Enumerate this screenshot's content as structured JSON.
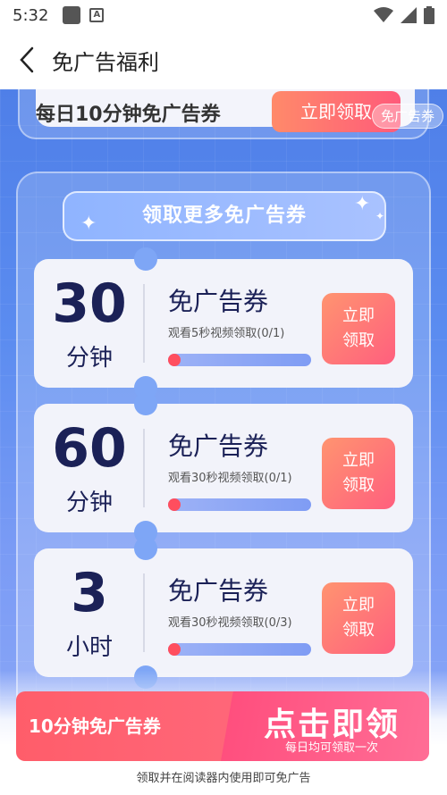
{
  "status": {
    "time": "5:32",
    "notice_letter": "A"
  },
  "nav": {
    "title": "免广告福利"
  },
  "top_card": {
    "text": "每日10分钟免广告券",
    "button": "立即领取",
    "badge": "免广告券"
  },
  "section": {
    "header": "领取更多免广告券"
  },
  "coupons": [
    {
      "amount": "30",
      "unit": "分钟",
      "title": "免广告券",
      "desc": "观看5秒视频领取(0/1)",
      "progress": 0,
      "btn_line1": "立即",
      "btn_line2": "领取"
    },
    {
      "amount": "60",
      "unit": "分钟",
      "title": "免广告券",
      "desc": "观看30秒视频领取(0/1)",
      "progress": 0,
      "btn_line1": "立即",
      "btn_line2": "领取"
    },
    {
      "amount": "3",
      "unit": "小时",
      "title": "免广告券",
      "desc": "观看30秒视频领取(0/3)",
      "progress": 0,
      "btn_line1": "立即",
      "btn_line2": "领取"
    }
  ],
  "bottom": {
    "left_text": "10分钟免广告券",
    "big_text": "点击即领",
    "small_text": "每日均可领取一次",
    "footnote": "领取并在阅读器内使用即可免广告"
  },
  "colors": {
    "accent": "#ff5a7a",
    "primary_dark": "#1b2157",
    "bg_blue": "#5b8cf0"
  }
}
